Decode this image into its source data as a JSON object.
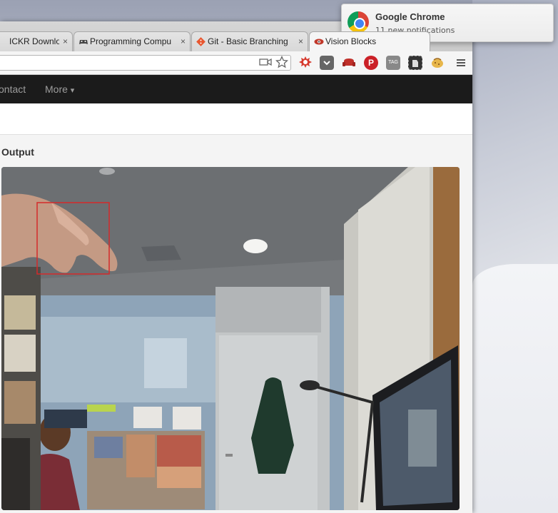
{
  "notification": {
    "title": "Google Chrome",
    "subtitle": "11 new notifications"
  },
  "browser": {
    "tabs": [
      {
        "label": "ICKR Downloa",
        "icon": "flickr-icon",
        "active": false
      },
      {
        "label": "Programming Compu",
        "icon": "gamepad-icon",
        "active": false
      },
      {
        "label": "Git - Basic Branching",
        "icon": "git-icon",
        "active": false
      },
      {
        "label": "Vision Blocks",
        "icon": "eye-icon",
        "active": true
      }
    ],
    "tab_close_glyph": "×",
    "extensions": [
      "flash-badge-icon",
      "pocket-icon",
      "sofa-icon",
      "pinterest-icon",
      "tag-icon",
      "evernote-icon",
      "cookie-icon",
      "menu-icon"
    ]
  },
  "site_nav": {
    "items": [
      {
        "label": "ontact"
      },
      {
        "label": "More"
      }
    ],
    "more_caret": "▾"
  },
  "page": {
    "section_title": "Output"
  },
  "colors": {
    "nav_bg": "#1b1b1b",
    "tracking_box": "#d42a2a"
  }
}
